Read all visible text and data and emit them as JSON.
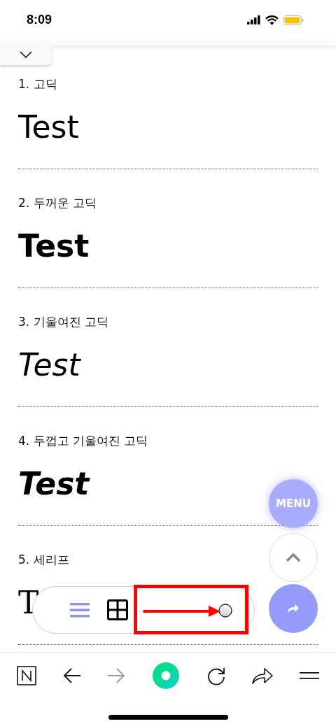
{
  "status_bar": {
    "time": "8:09"
  },
  "sections": [
    {
      "label": "1. 고딕",
      "sample": "Test",
      "kind": "regular"
    },
    {
      "label": "2. 두꺼운 고딕",
      "sample": "Test",
      "kind": "bold"
    },
    {
      "label": "3. 기울여진 고딕",
      "sample": "Test",
      "kind": "italic"
    },
    {
      "label": "4. 두껍고 기울여진 고딕",
      "sample": "Test",
      "kind": "boldItalic"
    },
    {
      "label": "5. 세리프",
      "sample": "T",
      "kind": "serif"
    }
  ],
  "floating_buttons": {
    "menu": "MENU"
  }
}
